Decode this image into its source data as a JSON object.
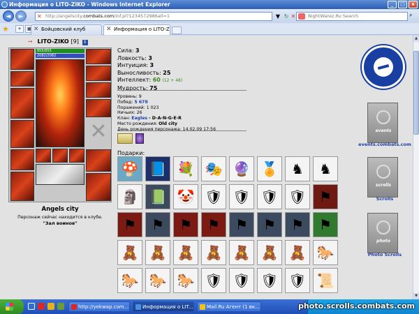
{
  "window": {
    "title": "Информация о LITO-ZIKO - Windows Internet Explorer",
    "btn_min": "_",
    "btn_max": "□",
    "btn_close": "x"
  },
  "address": {
    "url_prefix": "http://angelscity.",
    "url_domain": "combats.com",
    "url_suffix": "/inf.pl?1234572986all=1",
    "search_placeholder": "NightWarez.Ru Search",
    "back_glyph": "◄",
    "forward_glyph": "►",
    "dropdown_glyph": "▼",
    "refresh_glyph": "↻",
    "stop_glyph": "✕",
    "search_go_glyph": "⌕"
  },
  "tabs": [
    {
      "label": "Бойцовский клуб",
      "active": false
    },
    {
      "label": "Информация о LITO-ZIKO",
      "active": true
    }
  ],
  "character": {
    "arrow": "➙",
    "name": "LITO-ZIKO",
    "level": "[9]",
    "info_glyph": "i",
    "hp": "855/855",
    "mp": "2082/2082",
    "hp_fraction": 1.0,
    "mp_fraction": 1.0,
    "crossed_glyph": "✕"
  },
  "stats": {
    "strength_label": "Сила:",
    "strength_value": "3",
    "agility_label": "Ловкость:",
    "agility_value": "3",
    "intuition_label": "Интуиция:",
    "intuition_value": "3",
    "endurance_label": "Выносливость:",
    "endurance_value": "25",
    "intellect_label": "Интеллект:",
    "intellect_value": "60",
    "intellect_bonus": "(12 + 48)",
    "wisdom_label": "Мудрость:",
    "wisdom_value": "75"
  },
  "details": {
    "level_label": "Уровень:",
    "level_value": "9",
    "wins_label": "Побед:",
    "wins_value": "5 678",
    "losses_label": "Поражений:",
    "losses_value": "1 023",
    "draws_label": "Ничьих:",
    "draws_value": "26",
    "clan_label": "Клан:",
    "clan_value": "Eagles",
    "clan_rank": "- D-A-N-G-E-R",
    "birthplace_label": "Место рождения:",
    "birthplace_value": "Old city",
    "birthday_label": "День рождения персонажа:",
    "birthday_value": "14.02.09 17:56"
  },
  "location": {
    "city": "Angels city",
    "note": "Персонаж сейчас находится в клубе.",
    "room": "\"Зал воинов\""
  },
  "gifts": {
    "label": "Подарки:",
    "items": [
      {
        "name": "mushroom",
        "glyph": "🍄",
        "bg": "#6aa8c7"
      },
      {
        "name": "book",
        "glyph": "📘",
        "bg": "#1d2f6b"
      },
      {
        "name": "bouquet",
        "glyph": "💐",
        "bg": "#eeeeee"
      },
      {
        "name": "jester-hat",
        "glyph": "🎭",
        "bg": "#f4f4f4"
      },
      {
        "name": "crystal-ball",
        "glyph": "🔮",
        "bg": "#f4f4f4"
      },
      {
        "name": "medal",
        "glyph": "🏅",
        "bg": "#f4f4f4"
      },
      {
        "name": "knight",
        "glyph": "♞",
        "bg": "#f4f4f4"
      },
      {
        "name": "knight",
        "glyph": "♞",
        "bg": "#f4f4f4"
      },
      {
        "name": "statue",
        "glyph": "🗿",
        "bg": "#f4f4f4"
      },
      {
        "name": "tome",
        "glyph": "📗",
        "bg": "#3b4a5e"
      },
      {
        "name": "jester",
        "glyph": "🤡",
        "bg": "#f4f4f4"
      },
      {
        "name": "shield",
        "glyph": "🛡",
        "bg": "#f4f4f4"
      },
      {
        "name": "shield",
        "glyph": "🛡",
        "bg": "#f4f4f4"
      },
      {
        "name": "shield",
        "glyph": "🛡",
        "bg": "#f4f4f4"
      },
      {
        "name": "shield",
        "glyph": "🛡",
        "bg": "#f4f4f4"
      },
      {
        "name": "banner",
        "glyph": "⚑",
        "bg": "#6e1a12"
      },
      {
        "name": "banner",
        "glyph": "⚑",
        "bg": "#7a1a12"
      },
      {
        "name": "banner",
        "glyph": "⚑",
        "bg": "#3b4a5e"
      },
      {
        "name": "banner",
        "glyph": "⚑",
        "bg": "#7a1a12"
      },
      {
        "name": "banner",
        "glyph": "⚑",
        "bg": "#7a1a12"
      },
      {
        "name": "banner",
        "glyph": "⚑",
        "bg": "#3b4a5e"
      },
      {
        "name": "banner",
        "glyph": "⚑",
        "bg": "#3b4a5e"
      },
      {
        "name": "banner",
        "glyph": "⚑",
        "bg": "#3b4a5e"
      },
      {
        "name": "banner",
        "glyph": "⚑",
        "bg": "#2f7a2f"
      },
      {
        "name": "teddy",
        "glyph": "🧸",
        "bg": "#f4f4f4"
      },
      {
        "name": "teddy",
        "glyph": "🧸",
        "bg": "#f4f4f4"
      },
      {
        "name": "teddy",
        "glyph": "🧸",
        "bg": "#f4f4f4"
      },
      {
        "name": "teddy",
        "glyph": "🧸",
        "bg": "#f4f4f4"
      },
      {
        "name": "teddy",
        "glyph": "🧸",
        "bg": "#f4f4f4"
      },
      {
        "name": "teddy",
        "glyph": "🧸",
        "bg": "#f4f4f4"
      },
      {
        "name": "teddy",
        "glyph": "🧸",
        "bg": "#f4f4f4"
      },
      {
        "name": "rocking-horse",
        "glyph": "🐎",
        "bg": "#f4f4f4"
      },
      {
        "name": "rocking-horse",
        "glyph": "🐎",
        "bg": "#f4f4f4"
      },
      {
        "name": "rocking-horse",
        "glyph": "🐎",
        "bg": "#f4f4f4"
      },
      {
        "name": "rocking-horse",
        "glyph": "🐎",
        "bg": "#f4f4f4"
      },
      {
        "name": "shield",
        "glyph": "🛡",
        "bg": "#f4f4f4"
      },
      {
        "name": "shield",
        "glyph": "🛡",
        "bg": "#f4f4f4"
      },
      {
        "name": "shield",
        "glyph": "🛡",
        "bg": "#f4f4f4"
      },
      {
        "name": "shield",
        "glyph": "🛡",
        "bg": "#f4f4f4"
      },
      {
        "name": "scroll",
        "glyph": "📜",
        "bg": "#f4f4f4"
      }
    ]
  },
  "sidebar": {
    "events_link": "events.combats.com",
    "scrolls_banner": "scrolls",
    "scrolls_link": "Scrolls",
    "photo_banner": "photo",
    "photo_link": "Photo Scrolls",
    "events_banner": "events"
  },
  "taskbar": {
    "buttons": [
      {
        "label": "http://yekwap.com..."
      },
      {
        "label": "Информация о LIT..."
      },
      {
        "label": "Mail.Ru Агент (1 вк..."
      }
    ]
  },
  "watermark": "photo.scrolls.combats.com",
  "colors": {
    "accent_blue": "#1d3fa8",
    "intellect_green": "#3a8a1e",
    "hp_green": "#1f8c1f",
    "mp_blue": "#2f4fc0"
  }
}
